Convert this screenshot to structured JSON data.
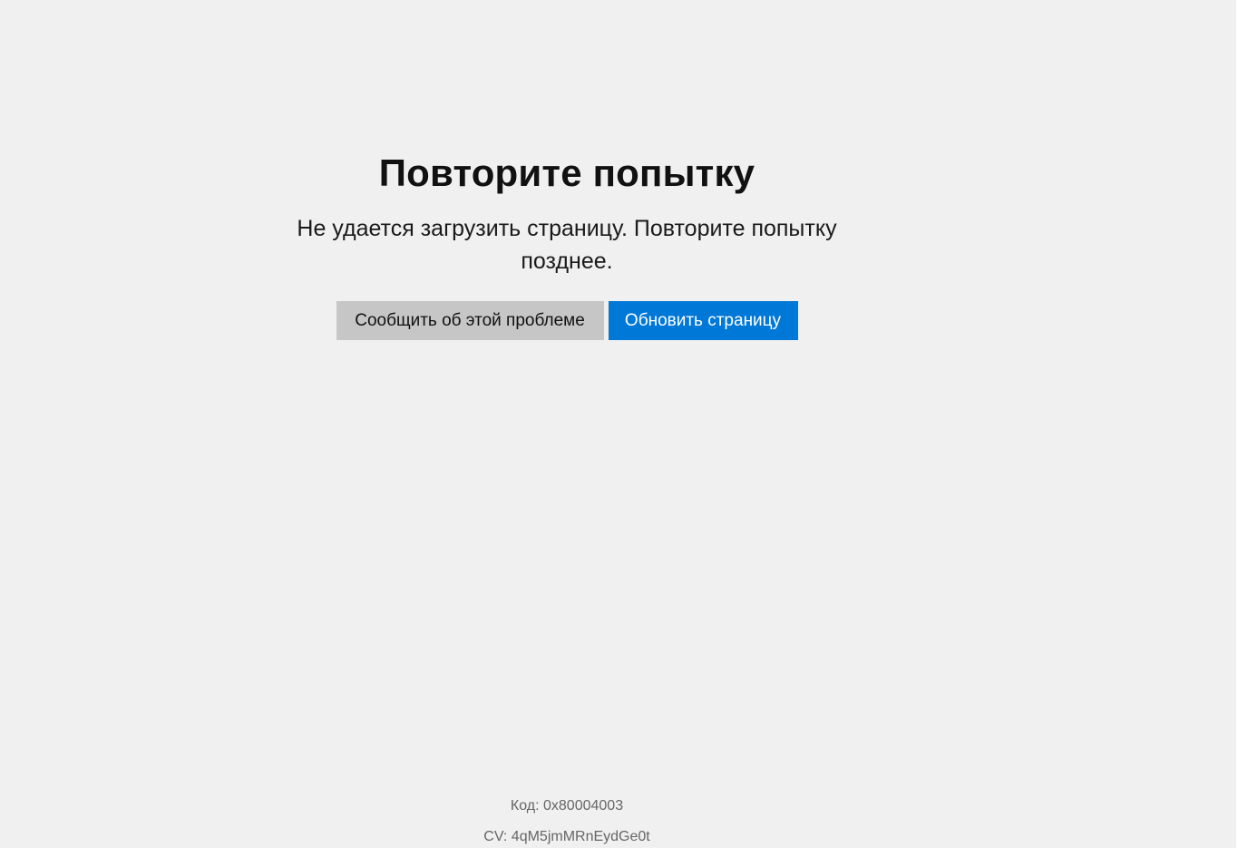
{
  "error": {
    "title": "Повторите попытку",
    "message": "Не удается загрузить страницу. Повторите попытку позднее."
  },
  "actions": {
    "report_label": "Сообщить об этой проблеме",
    "refresh_label": "Обновить страницу"
  },
  "footer": {
    "code": "Код: 0x80004003",
    "cv": "CV: 4qM5jmMRnEydGe0t"
  },
  "colors": {
    "background": "#f0f0f0",
    "primary_button": "#0078d7",
    "secondary_button": "#c6c6c6",
    "footer_text": "#666666"
  }
}
